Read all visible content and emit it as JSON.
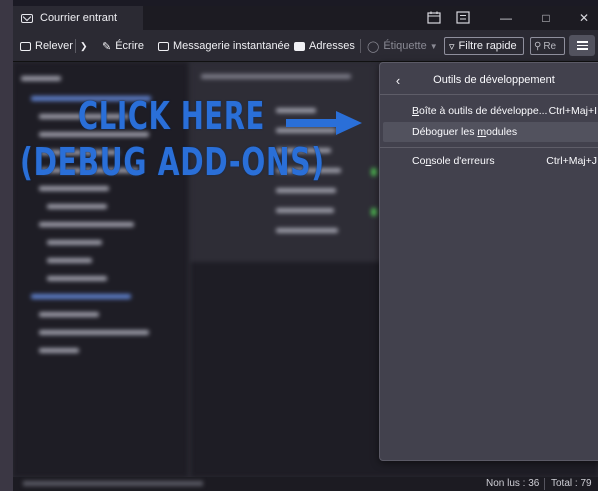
{
  "titlebar": {
    "tab_label": "Courrier entrant",
    "window_controls": [
      "calendar-icon",
      "tasks-icon",
      "minimize-icon",
      "maximize-icon",
      "close-icon"
    ]
  },
  "toolbar": {
    "get_messages": "Relever",
    "write": "Écrire",
    "chat": "Messagerie instantanée",
    "address_book": "Adresses",
    "tag": "Étiquette",
    "quick_filter": "Filtre rapide",
    "search_placeholder": "Re"
  },
  "annotation": {
    "line1": "CLICK HERE",
    "line2": "(DEBUG ADD-ONS)",
    "color": "#2a6fd8"
  },
  "devtools_panel": {
    "title": "Outils de développement",
    "items": [
      {
        "pre": "",
        "mnemonic": "B",
        "post": "oîte à outils de développe...",
        "shortcut": "Ctrl+Maj+I"
      },
      {
        "pre": "Déboguer les ",
        "mnemonic": "m",
        "post": "odules",
        "shortcut": ""
      },
      {
        "pre": "Co",
        "mnemonic": "n",
        "post": "sole d'erreurs",
        "shortcut": "Ctrl+Maj+J"
      }
    ]
  },
  "statusbar": {
    "unread": "Non lus : 36",
    "total": "Total : 79"
  }
}
